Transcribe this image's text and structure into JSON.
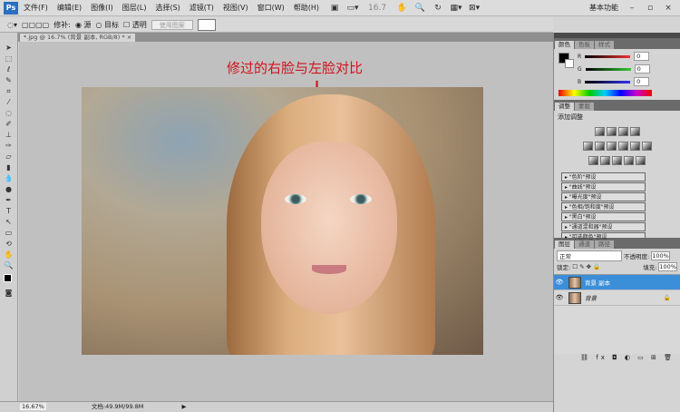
{
  "app": {
    "logo": "Ps",
    "menu": [
      "文件(F)",
      "编辑(E)",
      "图像(I)",
      "图层(L)",
      "选择(S)",
      "滤镜(T)",
      "视图(V)",
      "窗口(W)",
      "帮助(H)"
    ],
    "zoom_field": "16.7",
    "workspace": "基本功能"
  },
  "options": {
    "feather_label": "修补:",
    "source": "源",
    "target": "目标",
    "transparent": "透明",
    "use_pattern": "使用图案"
  },
  "document": {
    "tab": "*.jpg @ 16.7% (背景 副本, RGB/8) *",
    "caption": "修过的右脸与左脸对比",
    "arrow": "↓"
  },
  "status": {
    "zoom": "16.67%",
    "doc_size": "文档:49.9M/99.8M"
  },
  "color_panel": {
    "tabs": [
      "颜色",
      "色板",
      "样式"
    ],
    "R": "0",
    "G": "0",
    "B": "0"
  },
  "adjust_panel": {
    "tabs": [
      "调整",
      "蒙版"
    ],
    "title": "添加调整",
    "presets": [
      "\"色阶\"预设",
      "\"曲线\"预设",
      "\"曝光度\"预设",
      "\"色相/饱和度\"预设",
      "\"黑白\"预设",
      "\"通道混和器\"预设",
      "\"可选颜色\"预设"
    ]
  },
  "layers_panel": {
    "tabs": [
      "图层",
      "通道",
      "路径"
    ],
    "blend_mode": "正常",
    "opacity_label": "不透明度:",
    "opacity": "100%",
    "lock_label": "锁定:",
    "fill_label": "填充:",
    "fill": "100%",
    "layers": [
      {
        "name": "背景 副本",
        "selected": true
      },
      {
        "name": "背景",
        "locked": true
      }
    ]
  }
}
